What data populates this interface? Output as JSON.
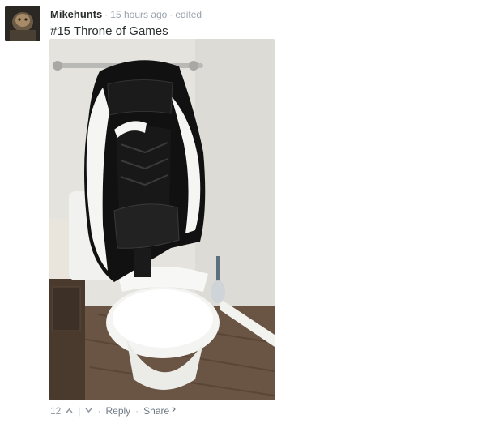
{
  "comment": {
    "author": "Mikehunts",
    "time": "15 hours ago",
    "edited": "edited",
    "text": "#15 Throne of Games",
    "votes": "12",
    "reply_label": "Reply",
    "share_label": "Share",
    "upvote_icon": "chevron-up-icon",
    "downvote_icon": "chevron-down-icon",
    "share_icon": "chevron-right-icon"
  },
  "colors": {
    "author": "#2a2e2e",
    "meta": "#9aa3ad",
    "footer": "#6f7a84"
  }
}
